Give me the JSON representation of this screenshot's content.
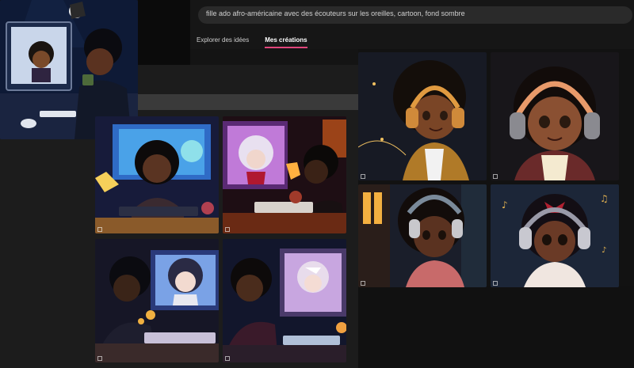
{
  "search": {
    "prompt": "fille ado afro-américaine avec des écouteurs sur les oreilles, cartoon, fond sombre"
  },
  "tabs": [
    {
      "label": "Explorer des idées",
      "active": false
    },
    {
      "label": "Mes créations",
      "active": true
    }
  ],
  "colors": {
    "accent": "#e0457b",
    "background": "#141414"
  }
}
